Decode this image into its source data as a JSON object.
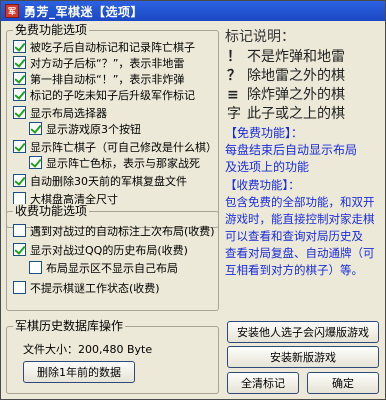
{
  "window": {
    "title": "勇芳_军棋迷【选项】",
    "icon_name": "app-logo-icon"
  },
  "free": {
    "legend": "免费功能选项",
    "options": [
      {
        "label": "被吃子后自动标记和记录阵亡棋子",
        "checked": true
      },
      {
        "label": "对方动子后标“？”，表示非地雷",
        "checked": true
      },
      {
        "label": "第一排自动标“！”，表示非炸弹",
        "checked": true
      },
      {
        "label": "标记的子吃未知子后升级军作标记",
        "checked": true
      },
      {
        "label": "显示布局选择器",
        "checked": true
      },
      {
        "label": "显示游戏原3个按钮",
        "checked": true
      },
      {
        "label": "显示阵亡棋子（可自己修改是什么棋）",
        "checked": true
      },
      {
        "label": "显示阵亡色标，表示与那家战死",
        "checked": true
      },
      {
        "label": "自动删除30天前的军棋复盘文件",
        "checked": true
      },
      {
        "label": "大棋盘高清全尺寸",
        "checked": false
      }
    ]
  },
  "paid": {
    "legend": "收费功能选项",
    "options": [
      {
        "label": "遇到对战过的自动标注上次布局(收费)",
        "checked": false
      },
      {
        "label": "显示对战过QQ的历史布局(收费)",
        "checked": true
      },
      {
        "label": "布局显示区不显示自己布局",
        "checked": false
      },
      {
        "label": "不提示棋谜工作状态(收费)",
        "checked": false
      }
    ]
  },
  "legend_panel": {
    "title": "标记说明：",
    "marks": [
      {
        "symbol": "！",
        "text": "不是炸弹和地雷"
      },
      {
        "symbol": "？",
        "text": "除地雷之外的棋"
      },
      {
        "symbol": "≡",
        "text": "除炸弹之外的棋"
      },
      {
        "symbol": "字",
        "text": "此子或之上的棋"
      }
    ]
  },
  "free_feature": {
    "title": "【免费功能】：",
    "lines": [
      "每盘结束后自动显示布局",
      "及选项上的功能"
    ]
  },
  "paid_feature": {
    "title": "【收费功能】：",
    "lines": [
      "包含免费的全部功能，和双开",
      "游戏时，能直接控制对家走棋",
      "可以查看和查询对局历史及",
      "查看对局复盘、自动通牌（可",
      "互相看到对方的棋子）等。"
    ]
  },
  "database": {
    "legend": "军棋历史数据库操作",
    "file_size_label": "文件大小：200,480 Byte",
    "delete_button": "删除1年前的数据"
  },
  "buttons": {
    "install_other": "安装他人选子会闪爆版游戏",
    "install_new": "安装新版游戏",
    "clear_marks": "全清标记",
    "ok": "确定"
  }
}
